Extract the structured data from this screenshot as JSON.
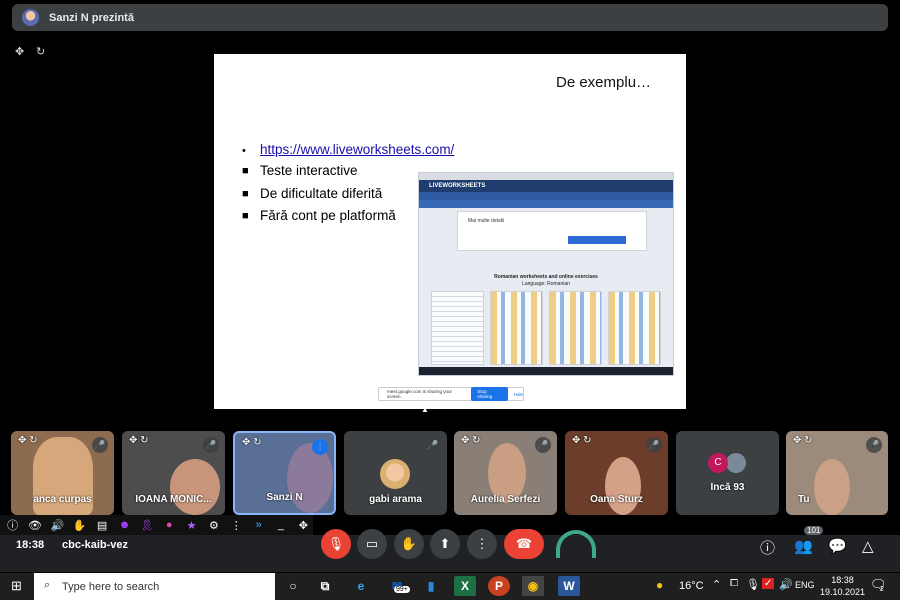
{
  "presenter": {
    "label": "Sanzi N prezintă"
  },
  "slide": {
    "heading": "De exemplu…",
    "link": "https://www.liveworksheets.com/",
    "bullets": [
      "Teste interactive",
      "De dificultate diferită",
      "Fără cont pe platformă"
    ],
    "embed": {
      "brand": "LIVEWORKSHEETS",
      "panel_text": "Mai multe detalii",
      "caption_1": "Romanian worksheets and online exercises",
      "caption_2": "Language: Romanian"
    },
    "share_banner": {
      "text": "meet.google.com is sharing your screen.",
      "stop": "Stop sharing",
      "hide": "Hide"
    }
  },
  "participants": [
    {
      "name": "anca curpas",
      "bg": "#8a6a4a",
      "muted": true
    },
    {
      "name": "IOANA MONIC...",
      "bg": "#4a4a4a",
      "muted": true
    },
    {
      "name": "Sanzi N",
      "bg": "#5a6f95",
      "muted": false,
      "active": true
    },
    {
      "name": "gabi arama",
      "bg": "#3c4043",
      "muted": true
    },
    {
      "name": "Aurelia Serfezi",
      "bg": "#7a6f67",
      "muted": true
    },
    {
      "name": "Oana Sturz",
      "bg": "#6a3a2a",
      "muted": true
    },
    {
      "name": "Încă 93",
      "bg": "#3c4043",
      "more": true
    },
    {
      "name": "Tu",
      "bg": "#9a8a7a",
      "muted": true
    }
  ],
  "more_avatar_letter": "C",
  "call": {
    "time": "18:38",
    "code": "cbc-kaib-vez",
    "people_count": "101"
  },
  "taskbar": {
    "search": "Type here to search",
    "weather": "16°C",
    "lang": "ENG",
    "time": "18:38",
    "date": "19.10.2021",
    "mail_badge": "99+",
    "notif_count": "2"
  }
}
